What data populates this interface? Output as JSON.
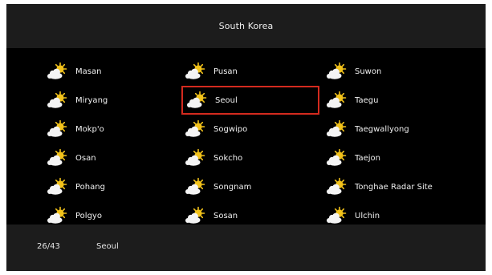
{
  "header": {
    "title": "South Korea"
  },
  "selected_index": 4,
  "cities": [
    {
      "name": "Masan",
      "icon": "partly-cloudy-icon"
    },
    {
      "name": "Miryang",
      "icon": "partly-cloudy-icon"
    },
    {
      "name": "Mokp'o",
      "icon": "partly-cloudy-icon"
    },
    {
      "name": "Osan",
      "icon": "partly-cloudy-icon"
    },
    {
      "name": "Pohang",
      "icon": "partly-cloudy-icon"
    },
    {
      "name": "Polgyo",
      "icon": "partly-cloudy-icon"
    },
    {
      "name": "Pusan",
      "icon": "partly-cloudy-icon"
    },
    {
      "name": "Seoul",
      "icon": "partly-cloudy-icon"
    },
    {
      "name": "Sogwipo",
      "icon": "partly-cloudy-icon"
    },
    {
      "name": "Sokcho",
      "icon": "partly-cloudy-icon"
    },
    {
      "name": "Songnam",
      "icon": "partly-cloudy-icon"
    },
    {
      "name": "Sosan",
      "icon": "partly-cloudy-icon"
    },
    {
      "name": "Suwon",
      "icon": "partly-cloudy-icon"
    },
    {
      "name": "Taegu",
      "icon": "partly-cloudy-icon"
    },
    {
      "name": "Taegwallyong",
      "icon": "partly-cloudy-icon"
    },
    {
      "name": "Taejon",
      "icon": "partly-cloudy-icon"
    },
    {
      "name": "Tonghae Radar Site",
      "icon": "partly-cloudy-icon"
    },
    {
      "name": "Ulchin",
      "icon": "partly-cloudy-icon"
    }
  ],
  "footer": {
    "count": "26/43",
    "selected_city": "Seoul"
  },
  "colors": {
    "selection": "#d42a1e",
    "bar": "#1c1c1c",
    "background": "#000000",
    "sun": "#f2c21a"
  }
}
